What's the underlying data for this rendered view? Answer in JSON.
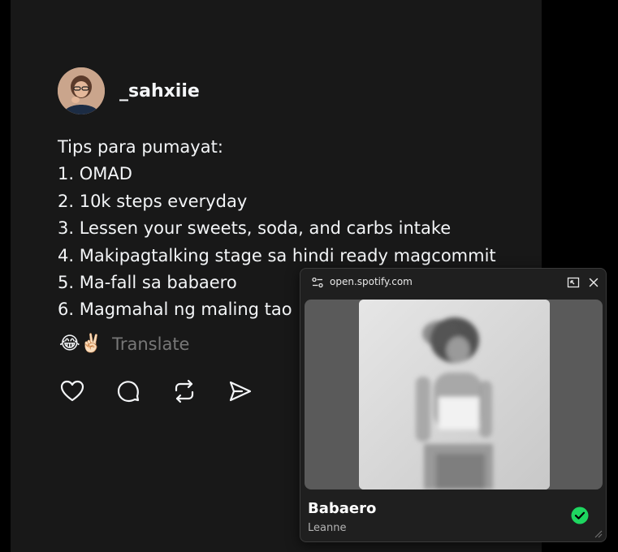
{
  "post": {
    "username": "_sahxiie",
    "lines": [
      "Tips para pumayat:",
      "1. OMAD",
      "2. 10k steps everyday",
      "3. Lessen your sweets, soda, and carbs intake",
      "4. Makipagtalking stage sa hindi ready magcommit",
      "5. Ma-fall sa babaero",
      "6. Magmahal ng maling tao"
    ],
    "emojis": [
      "😂",
      "✌🏻"
    ],
    "translate_label": "Translate",
    "actions": [
      "heart-icon",
      "comment-icon",
      "repost-icon",
      "share-icon"
    ]
  },
  "pip": {
    "url": "open.spotify.com",
    "track_title": "Babaero",
    "artist": "Leanne",
    "accent": "#1ed760"
  }
}
